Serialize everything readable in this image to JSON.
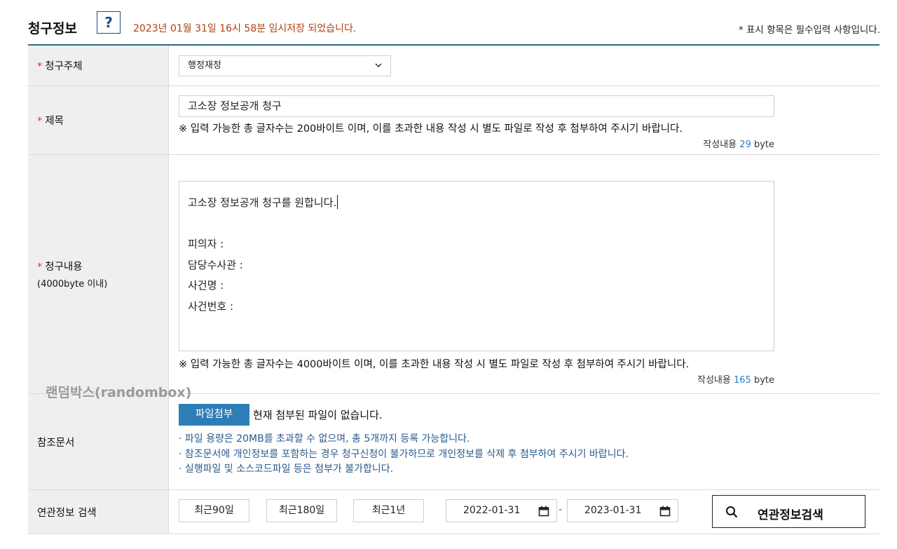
{
  "header": {
    "title": "청구정보",
    "help_label": "?",
    "save_message": "2023년 01월 31일 16시 58분 임시저장 되었습니다.",
    "required_note": "* 표시 항목은 필수입력 사항입니다."
  },
  "required_mark": "*",
  "subject": {
    "label": "청구주체",
    "selected": "행정재정"
  },
  "title_field": {
    "label": "제목",
    "value": "고소장 정보공개 청구",
    "hint": "※ 입력 가능한 총 글자수는 200바이트 이며, 이를 초과한 내용 작성 시 별도 파일로 작성 후 첨부하여 주시기 바랍니다.",
    "bytes_prefix": "작성내용",
    "bytes_value": "29",
    "bytes_unit": "byte"
  },
  "content_field": {
    "label": "청구내용",
    "sublabel": "(4000byte 이내)",
    "lines": [
      "고소장 정보공개 청구를 원합니다.",
      "",
      "피의자 :",
      "담당수사관 :",
      "사건명 :",
      "사건번호 :"
    ],
    "hint": "※ 입력 가능한 총 글자수는 4000바이트 이며, 이를 초과한 내용 작성 시 별도 파일로 작성 후 첨부하여 주시기 바랍니다.",
    "bytes_prefix": "작성내용",
    "bytes_value": "165",
    "bytes_unit": "byte"
  },
  "watermark": "랜덤박스(randombox)",
  "reference": {
    "label": "참조문서",
    "attach_button": "파일첨부",
    "no_file_text": "현재 첨부된 파일이 없습니다.",
    "notes": [
      "· 파일 용량은 20MB를 초과할 수 없으며, 총 5개까지 등록 가능합니다.",
      "· 참조문서에 개인정보를 포함하는 경우 청구신청이 불가하므로 개인정보를 삭제 후 첨부하여 주시기 바랍니다.",
      "· 실행파일 및 소스코드파일 등은 첨부가 불가합니다."
    ]
  },
  "related_search": {
    "label": "연관정보 검색",
    "range_buttons": [
      "최근90일",
      "최근180일",
      "최근1년"
    ],
    "date_from": "2022-01-31",
    "date_to": "2023-01-31",
    "date_separator": "-",
    "search_button": "연관정보검색"
  },
  "colors": {
    "accent": "#2e7db6",
    "table_top_border": "#2a6a86",
    "save_message": "#b0400f",
    "required_star": "#dd3333",
    "byte_count": "#2c7cc3",
    "notes_text": "#2a5a8c"
  },
  "icons": {
    "help": "question-mark",
    "select": "chevron-down-icon",
    "date": "calendar-icon",
    "search": "magnifier-icon"
  }
}
